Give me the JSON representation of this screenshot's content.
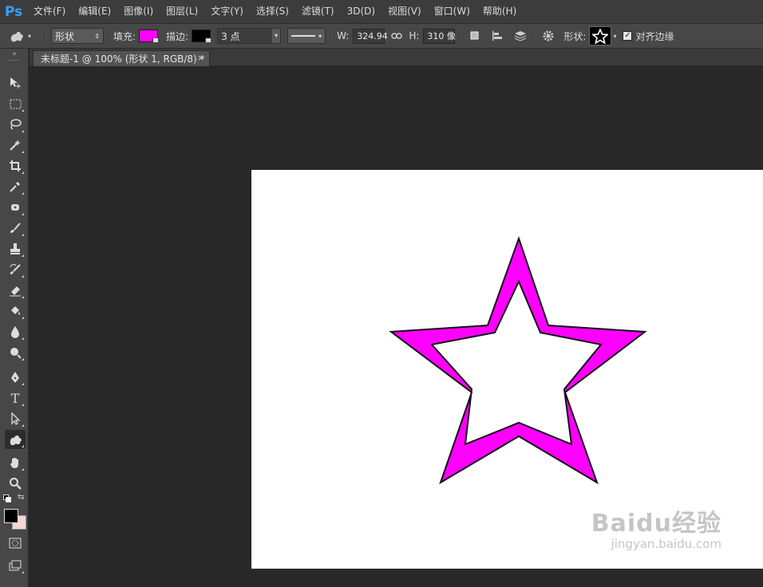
{
  "app": {
    "logo": "Ps"
  },
  "menu": [
    "文件(F)",
    "编辑(E)",
    "图像(I)",
    "图层(L)",
    "文字(Y)",
    "选择(S)",
    "滤镜(T)",
    "3D(D)",
    "视图(V)",
    "窗口(W)",
    "帮助(H)"
  ],
  "options": {
    "mode": "形状",
    "fill_label": "填充:",
    "fill_color": "#ff00ff",
    "stroke_label": "描边:",
    "stroke_color": "#000000",
    "stroke_width": "3 点",
    "w_label": "W:",
    "w_value": "324.94",
    "h_label": "H:",
    "h_value": "310 像",
    "shape_label": "形状:",
    "align_edges": "对齐边缘"
  },
  "document": {
    "tab_title": "未标题-1 @ 100% (形状 1, RGB/8) *",
    "close": "×"
  },
  "tools": [
    "move-tool",
    "marquee-tool",
    "lasso-tool",
    "magic-wand-tool",
    "crop-tool",
    "eyedropper-tool",
    "healing-brush-tool",
    "brush-tool",
    "clone-stamp-tool",
    "history-brush-tool",
    "eraser-tool",
    "paint-bucket-tool",
    "blur-tool",
    "dodge-tool",
    "pen-tool",
    "type-tool",
    "path-selection-tool",
    "custom-shape-tool",
    "hand-tool",
    "zoom-tool"
  ],
  "colors": {
    "foreground": "#000000",
    "background": "#f5d6d6",
    "shape_fill": "#ff00ff",
    "shape_stroke": "#000000"
  },
  "watermark": {
    "main": "Baidu经验",
    "sub": "jingyan.baidu.com"
  }
}
